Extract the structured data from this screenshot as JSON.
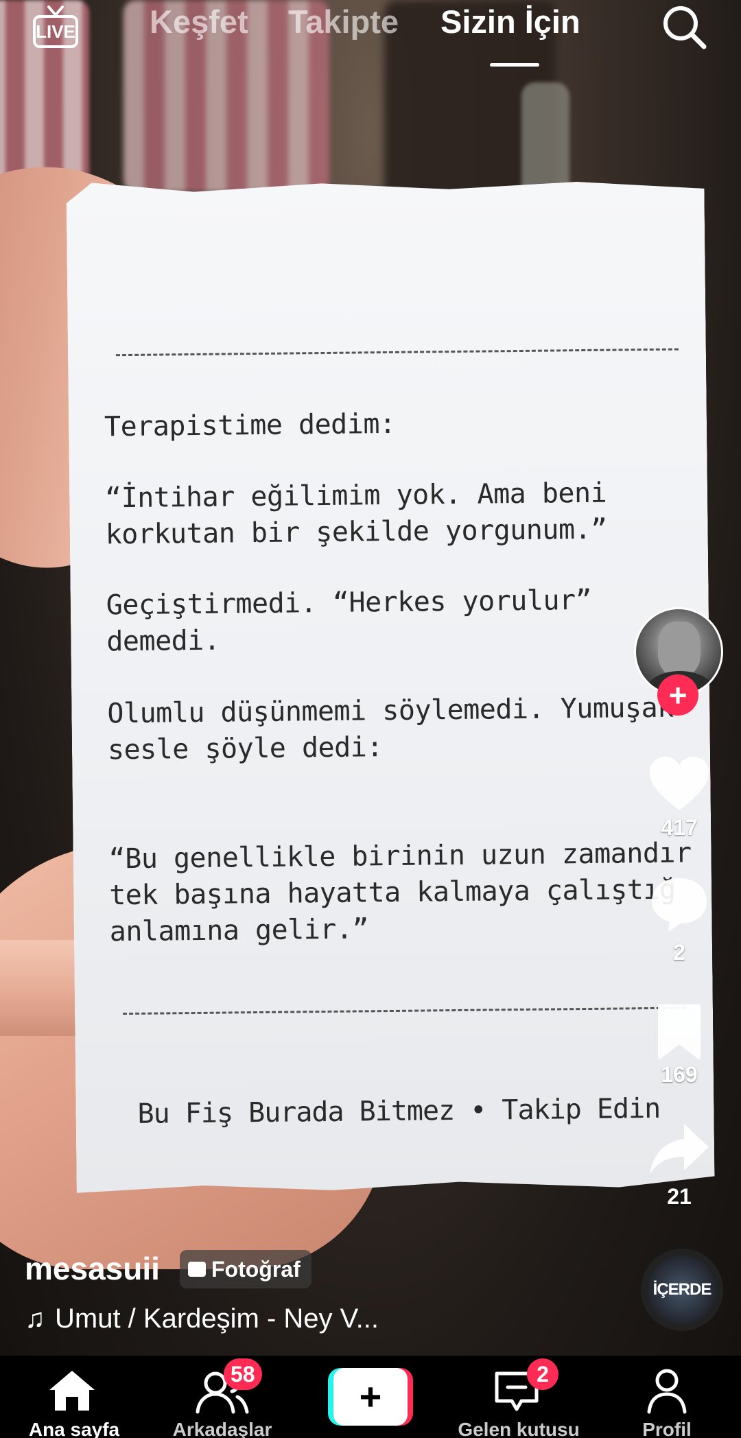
{
  "topnav": {
    "live_label": "LIVE",
    "tabs": [
      {
        "label": "Keşfet",
        "active": false
      },
      {
        "label": "Takipte",
        "active": false
      },
      {
        "label": "Sizin İçin",
        "active": true
      }
    ]
  },
  "post": {
    "receipt_lines": {
      "p1": "Terapistime dedim:",
      "p2": "“İntihar eğilimim yok. Ama beni\nkorkutan bir şekilde yorgunum.”",
      "p3": "Geçiştirmedi. “Herkes yorulur”\ndemedi.",
      "p4": "Olumlu düşünmemi söylemedi. Yumuşak\nsesle şöyle dedi:",
      "p5": "“Bu genellikle birinin uzun zamandır\ntek başına hayatta kalmaya çalıştığ\nanlamına gelir.”",
      "footer": "Bu Fiş Burada Bitmez • Takip Edin"
    },
    "username": "mesasuii",
    "type_badge": "Fotoğraf",
    "song": "Umut / Kardeşim - Ney V...",
    "disc_label": "İÇERDE"
  },
  "rail": {
    "likes": "417",
    "comments": "2",
    "saves": "169",
    "shares": "21"
  },
  "bottombar": {
    "items": [
      {
        "label": "Ana sayfa"
      },
      {
        "label": "Arkadaşlar",
        "badge": "58"
      },
      {
        "label": "Gelen kutusu",
        "badge": "2"
      },
      {
        "label": "Profil"
      }
    ]
  },
  "colors": {
    "accent_red": "#fe2c55",
    "accent_cyan": "#25f4ee"
  }
}
